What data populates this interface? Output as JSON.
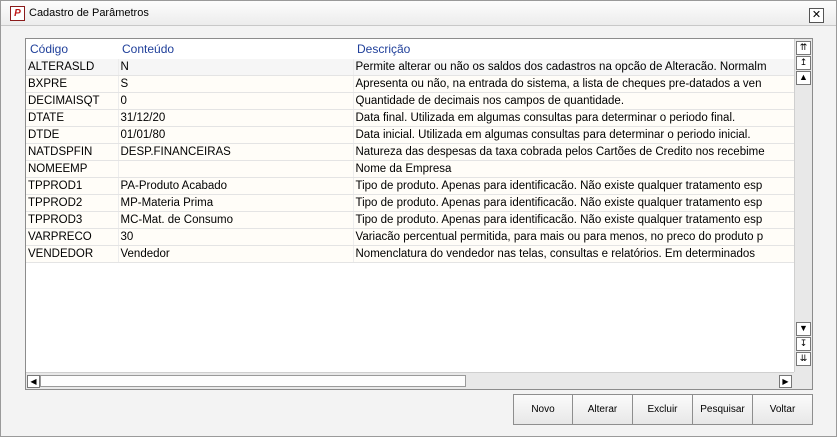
{
  "window": {
    "title": "Cadastro de Parâmetros",
    "app_icon": "P",
    "close_glyph": "✕"
  },
  "grid": {
    "columns": [
      "Código",
      "Conteúdo",
      "Descrição"
    ],
    "rows": [
      [
        "ALTERASLD",
        "N",
        "Permite alterar ou não os saldos dos cadastros na opcão de Alteracão. Normalm"
      ],
      [
        "BXPRE",
        "S",
        "Apresenta ou não, na entrada do sistema, a lista de cheques pre-datados a ven"
      ],
      [
        "DECIMAISQT",
        "0",
        "Quantidade de decimais nos campos de quantidade."
      ],
      [
        "DTATE",
        "31/12/20",
        "Data final. Utilizada em algumas consultas para determinar o periodo final."
      ],
      [
        "DTDE",
        "01/01/80",
        "Data inicial. Utilizada em algumas consultas para determinar o periodo inicial."
      ],
      [
        "NATDSPFIN",
        "DESP.FINANCEIRAS",
        "Natureza das despesas da taxa cobrada pelos Cartões de Credito nos recebime"
      ],
      [
        "NOMEEMP",
        "",
        "Nome da Empresa"
      ],
      [
        "TPPROD1",
        "PA-Produto Acabado",
        "Tipo de produto. Apenas para identificacão. Não existe qualquer tratamento esp"
      ],
      [
        "TPPROD2",
        "MP-Materia Prima",
        "Tipo de produto. Apenas para identificacão. Não existe qualquer tratamento esp"
      ],
      [
        "TPPROD3",
        "MC-Mat. de Consumo",
        "Tipo de produto. Apenas para identificacão. Não existe qualquer tratamento esp"
      ],
      [
        "VARPRECO",
        "30",
        "Variacão percentual permitida, para mais ou para menos, no preco do produto p"
      ],
      [
        "VENDEDOR",
        "Vendedor",
        "Nomenclatura do vendedor nas telas, consultas e relatórios. Em determinados "
      ]
    ]
  },
  "scroll": {
    "first": "⇈",
    "prev_page": "↥",
    "up": "▲",
    "down": "▼",
    "next_page": "↧",
    "last": "⇊",
    "left": "◀",
    "right": "▶"
  },
  "actions": {
    "new": "Novo",
    "edit": "Alterar",
    "delete": "Excluir",
    "search": "Pesquisar",
    "back": "Voltar"
  }
}
